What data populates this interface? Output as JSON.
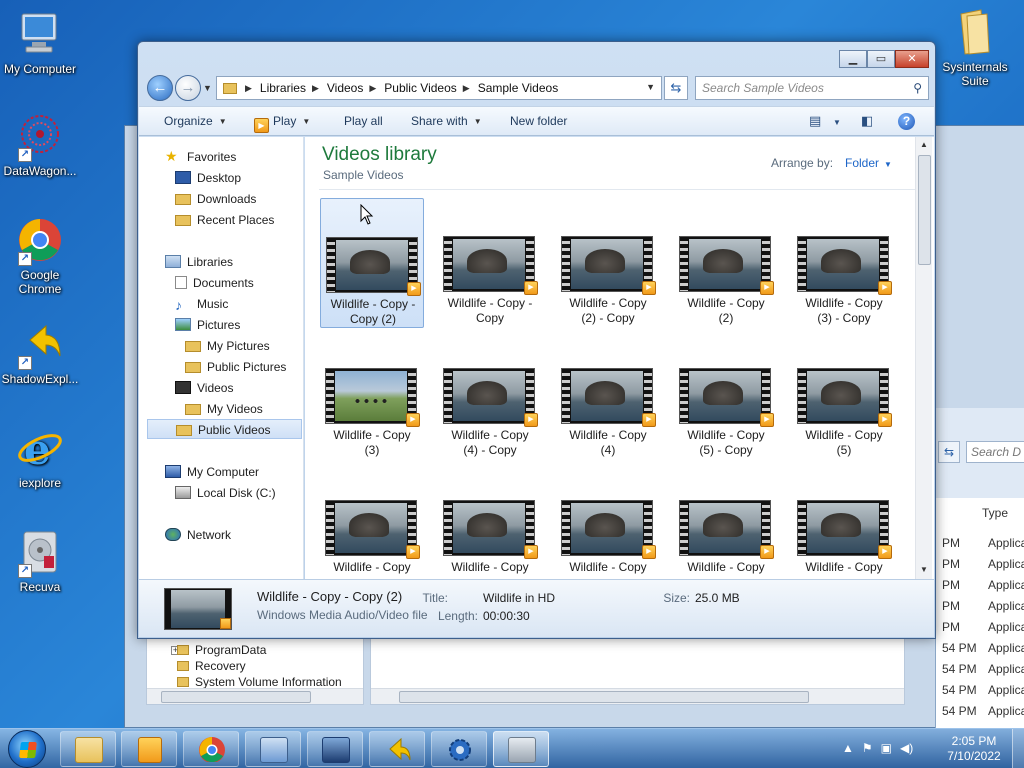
{
  "desktop": {
    "icons": [
      {
        "label": "My Computer",
        "icon": "computer-icon"
      },
      {
        "label": "DataWagon...",
        "icon": "datawagon-icon"
      },
      {
        "label": "Google Chrome",
        "icon": "chrome-icon"
      },
      {
        "label": "ShadowExpl...",
        "icon": "shadowexplorer-icon"
      },
      {
        "label": "iexplore",
        "icon": "ie-icon"
      },
      {
        "label": "Recuva",
        "icon": "recuva-icon"
      },
      {
        "label": "Sysinternals Suite",
        "icon": "folder-icon"
      }
    ]
  },
  "background_window": {
    "search_placeholder": "Search D",
    "column_type": "Type",
    "rows": [
      {
        "time": "PM",
        "type": "Applicati"
      },
      {
        "time": "PM",
        "type": "Applicati"
      },
      {
        "time": "PM",
        "type": "Applicati"
      },
      {
        "time": "PM",
        "type": "Applicati"
      },
      {
        "time": "PM",
        "type": "Applicati"
      },
      {
        "time": "54 PM",
        "type": "Applicati"
      },
      {
        "time": "54 PM",
        "type": "Applicati"
      },
      {
        "time": "54 PM",
        "type": "Applicati"
      },
      {
        "time": "54 PM",
        "type": "Applicati"
      }
    ],
    "tree": [
      "ProgramData",
      "Recovery",
      "System Volume Information"
    ]
  },
  "explorer": {
    "breadcrumb": [
      "Libraries",
      "Videos",
      "Public Videos",
      "Sample Videos"
    ],
    "search_placeholder": "Search Sample Videos",
    "toolbar": {
      "organize": "Organize",
      "play": "Play",
      "play_all": "Play all",
      "share_with": "Share with",
      "new_folder": "New folder"
    },
    "nav": {
      "favorites": "Favorites",
      "desktop": "Desktop",
      "downloads": "Downloads",
      "recent_places": "Recent Places",
      "libraries": "Libraries",
      "documents": "Documents",
      "music": "Music",
      "pictures": "Pictures",
      "my_pictures": "My Pictures",
      "public_pictures": "Public Pictures",
      "videos": "Videos",
      "my_videos": "My Videos",
      "public_videos": "Public Videos",
      "my_computer": "My Computer",
      "local_disk": "Local Disk (C:)",
      "network": "Network"
    },
    "library_title": "Videos library",
    "library_subtitle": "Sample Videos",
    "arrange_by_label": "Arrange by:",
    "arrange_by_value": "Folder",
    "files": [
      [
        "Wildlife - Copy -",
        "Copy (2)"
      ],
      [
        "Wildlife - Copy -",
        "Copy"
      ],
      [
        "Wildlife - Copy",
        "(2) - Copy"
      ],
      [
        "Wildlife - Copy",
        "(2)"
      ],
      [
        "Wildlife - Copy",
        "(3) - Copy"
      ],
      [
        "Wildlife - Copy",
        "(3)"
      ],
      [
        "Wildlife - Copy",
        "(4) - Copy"
      ],
      [
        "Wildlife - Copy",
        "(4)"
      ],
      [
        "Wildlife - Copy",
        "(5) - Copy"
      ],
      [
        "Wildlife - Copy",
        "(5)"
      ],
      [
        "Wildlife - Copy",
        ""
      ],
      [
        "Wildlife - Copy",
        ""
      ],
      [
        "Wildlife - Copy",
        ""
      ],
      [
        "Wildlife - Copy",
        ""
      ],
      [
        "Wildlife - Copy",
        ""
      ]
    ],
    "details": {
      "name": "Wildlife - Copy - Copy (2)",
      "type": "Windows Media Audio/Video file",
      "title_label": "Title:",
      "title_value": "Wildlife in HD",
      "length_label": "Length:",
      "length_value": "00:00:30",
      "size_label": "Size:",
      "size_value": "25.0 MB"
    }
  },
  "taskbar": {
    "buttons": [
      "explorer-icon",
      "media-player-icon",
      "chrome-icon",
      "control-panel-icon",
      "remote-desktop-icon",
      "shadowexplorer-icon",
      "settings-icon",
      "recuva-icon"
    ],
    "time": "2:05 PM",
    "date": "7/10/2022"
  }
}
